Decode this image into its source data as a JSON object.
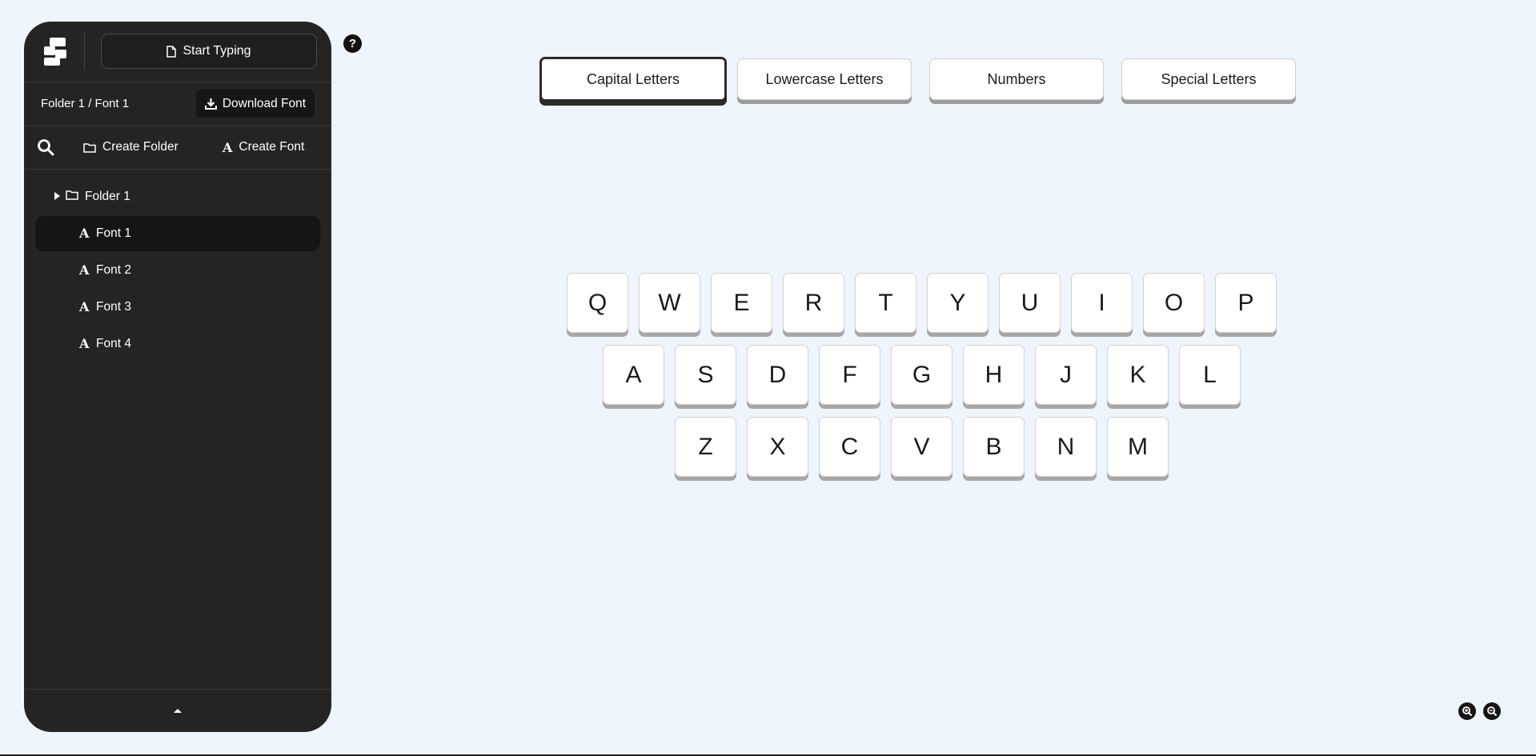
{
  "sidebar": {
    "start_typing_label": "Start Typing",
    "path": "Folder 1 / Font 1",
    "download_label": "Download Font",
    "create_folder_label": "Create Folder",
    "create_font_label": "Create Font",
    "tree": {
      "folder_label": "Folder 1",
      "fonts": [
        "Font 1",
        "Font 2",
        "Font 3",
        "Font 4"
      ],
      "active_font": "Font 1"
    }
  },
  "help_label": "?",
  "tabs": [
    "Capital Letters",
    "Lowercase Letters",
    "Numbers",
    "Special Letters"
  ],
  "active_tab": "Capital Letters",
  "keyboard": {
    "row1": [
      "Q",
      "W",
      "E",
      "R",
      "T",
      "Y",
      "U",
      "I",
      "O",
      "P"
    ],
    "row2": [
      "A",
      "S",
      "D",
      "F",
      "G",
      "H",
      "J",
      "K",
      "L"
    ],
    "row3": [
      "Z",
      "X",
      "C",
      "V",
      "B",
      "N",
      "M"
    ]
  },
  "icons": {
    "logo": "app-logo",
    "start": "document-icon",
    "download": "download-icon",
    "search": "search-icon",
    "folder": "folder-icon",
    "font": "font-a-icon",
    "collapse": "caret-up-icon",
    "zoom_in": "zoom-in-icon",
    "zoom_out": "zoom-out-icon"
  }
}
